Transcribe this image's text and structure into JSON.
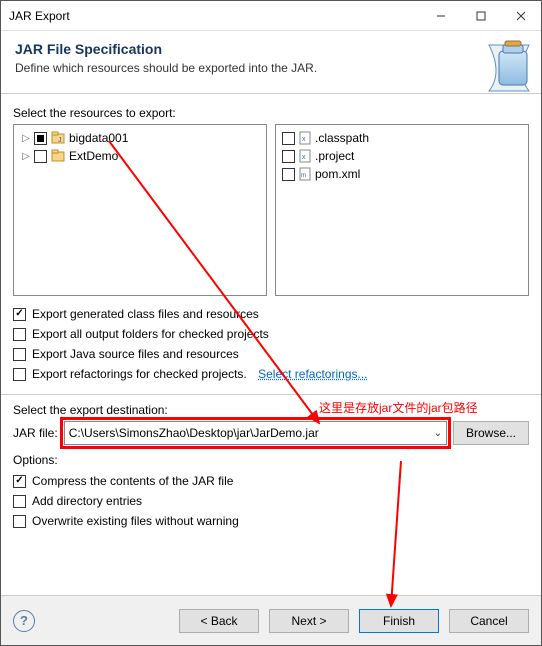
{
  "window": {
    "title": "JAR Export"
  },
  "header": {
    "title": "JAR File Specification",
    "subtitle": "Define which resources should be exported into the JAR."
  },
  "sections": {
    "select_resources_label": "Select the resources to export:",
    "select_destination_label": "Select the export destination:",
    "options_label": "Options:",
    "jar_file_label": "JAR file:"
  },
  "left_tree": {
    "items": [
      {
        "label": "bigdata001",
        "checked": "partial"
      },
      {
        "label": "ExtDemo",
        "checked": ""
      }
    ]
  },
  "right_list": {
    "items": [
      {
        "label": ".classpath",
        "checked": ""
      },
      {
        "label": ".project",
        "checked": ""
      },
      {
        "label": "pom.xml",
        "checked": ""
      }
    ]
  },
  "export_opts": {
    "generated": {
      "label": "Export generated class files and resources",
      "checked": true
    },
    "output_folders": {
      "label": "Export all output folders for checked projects",
      "checked": false
    },
    "java_source": {
      "label": "Export Java source files and resources",
      "checked": false
    },
    "refactorings": {
      "label": "Export refactorings for checked projects.",
      "checked": false
    },
    "refactorings_link": "Select refactorings..."
  },
  "destination": {
    "value": "C:\\Users\\SimonsZhao\\Desktop\\jar\\JarDemo.jar",
    "browse_label": "Browse..."
  },
  "options2": {
    "compress": {
      "label": "Compress the contents of the JAR file",
      "checked": true
    },
    "add_dir": {
      "label": "Add directory entries",
      "checked": false
    },
    "overwrite": {
      "label": "Overwrite existing files without warning",
      "checked": false
    }
  },
  "footer": {
    "back": "< Back",
    "next": "Next >",
    "finish": "Finish",
    "cancel": "Cancel",
    "help": "?"
  },
  "annotation": {
    "text": "这里是存放jar文件的jar包路径"
  }
}
